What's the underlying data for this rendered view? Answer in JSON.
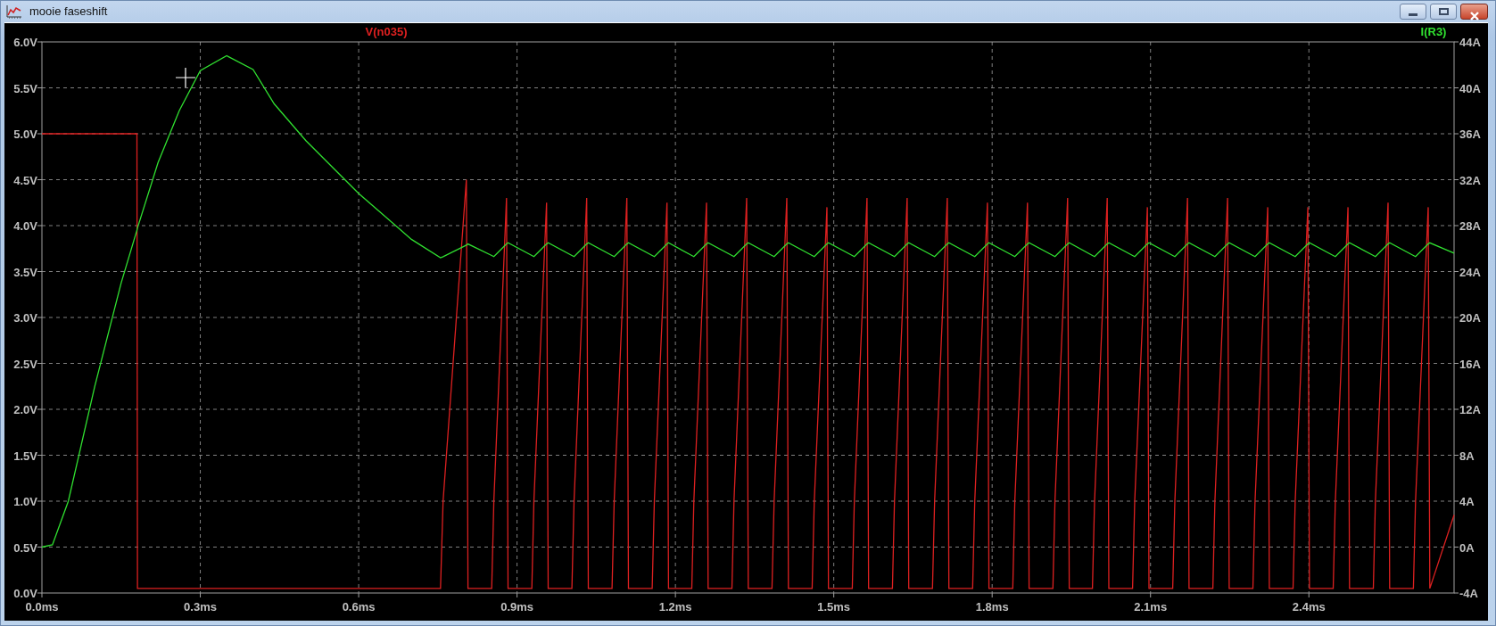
{
  "window": {
    "title": "mooie faseshift"
  },
  "plot": {
    "chart_data": {
      "type": "line",
      "grid": true,
      "xlim": [
        0,
        2.675
      ],
      "ylim": [
        0,
        6
      ],
      "y2lim": [
        -4,
        44
      ],
      "xticks": [
        {
          "value": 0,
          "label": "0.0ms"
        },
        {
          "value": 0.3,
          "label": "0.3ms"
        },
        {
          "value": 0.6,
          "label": "0.6ms"
        },
        {
          "value": 0.9,
          "label": "0.9ms"
        },
        {
          "value": 1.2,
          "label": "1.2ms"
        },
        {
          "value": 1.5,
          "label": "1.5ms"
        },
        {
          "value": 1.8,
          "label": "1.8ms"
        },
        {
          "value": 2.1,
          "label": "2.1ms"
        },
        {
          "value": 2.4,
          "label": "2.4ms"
        }
      ],
      "yticks": [
        {
          "value": 0,
          "label": "0.0V"
        },
        {
          "value": 0.5,
          "label": "0.5V"
        },
        {
          "value": 1,
          "label": "1.0V"
        },
        {
          "value": 1.5,
          "label": "1.5V"
        },
        {
          "value": 2,
          "label": "2.0V"
        },
        {
          "value": 2.5,
          "label": "2.5V"
        },
        {
          "value": 3,
          "label": "3.0V"
        },
        {
          "value": 3.5,
          "label": "3.5V"
        },
        {
          "value": 4,
          "label": "4.0V"
        },
        {
          "value": 4.5,
          "label": "4.5V"
        },
        {
          "value": 5,
          "label": "5.0V"
        },
        {
          "value": 5.5,
          "label": "5.5V"
        },
        {
          "value": 6,
          "label": "6.0V"
        }
      ],
      "y2ticks": [
        {
          "value": -4,
          "label": "-4A"
        },
        {
          "value": 0,
          "label": "0A"
        },
        {
          "value": 4,
          "label": "4A"
        },
        {
          "value": 8,
          "label": "8A"
        },
        {
          "value": 12,
          "label": "12A"
        },
        {
          "value": 16,
          "label": "16A"
        },
        {
          "value": 20,
          "label": "20A"
        },
        {
          "value": 24,
          "label": "24A"
        },
        {
          "value": 28,
          "label": "28A"
        },
        {
          "value": 32,
          "label": "32A"
        },
        {
          "value": 36,
          "label": "36A"
        },
        {
          "value": 40,
          "label": "40A"
        },
        {
          "value": 44,
          "label": "44A"
        }
      ],
      "x": [
        0,
        0.02,
        0.05,
        0.1,
        0.15,
        0.18,
        0.181,
        0.22,
        0.26,
        0.3,
        0.35,
        0.4,
        0.44,
        0.5,
        0.6,
        0.7,
        0.755,
        0.76,
        0.804,
        0.807,
        0.852,
        0.856,
        0.88,
        0.883,
        0.928,
        0.932,
        0.956,
        0.959,
        1.004,
        1.008,
        1.032,
        1.035,
        1.08,
        1.084,
        1.108,
        1.111,
        1.156,
        1.16,
        1.184,
        1.187,
        1.231,
        1.235,
        1.259,
        1.262,
        1.307,
        1.311,
        1.335,
        1.338,
        1.383,
        1.387,
        1.411,
        1.414,
        1.459,
        1.463,
        1.487,
        1.49,
        1.535,
        1.539,
        1.563,
        1.566,
        1.611,
        1.615,
        1.639,
        1.642,
        1.687,
        1.691,
        1.715,
        1.718,
        1.763,
        1.767,
        1.791,
        1.794,
        1.839,
        1.843,
        1.867,
        1.87,
        1.915,
        1.919,
        1.943,
        1.946,
        1.99,
        1.994,
        2.018,
        2.021,
        2.066,
        2.07,
        2.094,
        2.097,
        2.142,
        2.146,
        2.17,
        2.173,
        2.218,
        2.222,
        2.246,
        2.249,
        2.294,
        2.298,
        2.322,
        2.325,
        2.37,
        2.374,
        2.398,
        2.401,
        2.446,
        2.45,
        2.474,
        2.477,
        2.522,
        2.526,
        2.55,
        2.553,
        2.598,
        2.602,
        2.626,
        2.629,
        2.675
      ],
      "series": [
        {
          "name": "V(n035)",
          "color": "#dd2020",
          "values": [
            5,
            5,
            5,
            5,
            5,
            5,
            0.05,
            0.05,
            0.05,
            0.05,
            0.05,
            0.05,
            0.05,
            0.05,
            0.05,
            0.05,
            0.05,
            1.0,
            4.5,
            0.05,
            0.05,
            1.0,
            4.3,
            0.05,
            0.05,
            1.0,
            4.25,
            0.05,
            0.05,
            1.0,
            4.3,
            0.05,
            0.05,
            1.0,
            4.3,
            0.05,
            0.05,
            1.0,
            4.25,
            0.05,
            0.05,
            1.0,
            4.25,
            0.05,
            0.05,
            1.0,
            4.3,
            0.05,
            0.05,
            1.0,
            4.3,
            0.05,
            0.05,
            1.0,
            4.2,
            0.05,
            0.05,
            1.0,
            4.3,
            0.05,
            0.05,
            1.0,
            4.3,
            0.05,
            0.05,
            1.0,
            4.3,
            0.05,
            0.05,
            1.0,
            4.25,
            0.05,
            0.05,
            1.0,
            4.25,
            0.05,
            0.05,
            1.0,
            4.3,
            0.05,
            0.05,
            1.0,
            4.3,
            0.05,
            0.05,
            1.0,
            4.2,
            0.05,
            0.05,
            1.0,
            4.3,
            0.05,
            0.05,
            1.0,
            4.3,
            0.05,
            0.05,
            1.0,
            4.2,
            0.05,
            0.05,
            1.0,
            4.2,
            0.05,
            0.05,
            1.0,
            4.2,
            0.05,
            0.05,
            1.0,
            4.25,
            0.05,
            0.05,
            1.0,
            4.2,
            0.05,
            0.85
          ]
        },
        {
          "name": "I(R3)",
          "color": "#30e030",
          "axis": "y2",
          "values": [
            0,
            0.2,
            4,
            14,
            23,
            27.6,
            27.8,
            33.5,
            38,
            41.5,
            42.8,
            41.6,
            38.6,
            35.4,
            30.8,
            26.8,
            25.2,
            25.3,
            26.3,
            26.4,
            25.4,
            25.3,
            26.4,
            26.5,
            25.4,
            25.3,
            26.4,
            26.5,
            25.4,
            25.3,
            26.4,
            26.5,
            25.4,
            25.3,
            26.4,
            26.5,
            25.4,
            25.3,
            26.4,
            26.5,
            25.4,
            25.3,
            26.4,
            26.5,
            25.4,
            25.3,
            26.4,
            26.5,
            25.4,
            25.3,
            26.4,
            26.5,
            25.4,
            25.3,
            26.4,
            26.5,
            25.4,
            25.3,
            26.4,
            26.5,
            25.4,
            25.3,
            26.4,
            26.5,
            25.4,
            25.3,
            26.4,
            26.5,
            25.4,
            25.3,
            26.4,
            26.5,
            25.4,
            25.3,
            26.4,
            26.5,
            25.4,
            25.3,
            26.4,
            26.5,
            25.4,
            25.3,
            26.4,
            26.5,
            25.4,
            25.3,
            26.4,
            26.5,
            25.4,
            25.3,
            26.4,
            26.5,
            25.4,
            25.3,
            26.4,
            26.5,
            25.4,
            25.3,
            26.4,
            26.5,
            25.4,
            25.3,
            26.4,
            26.5,
            25.4,
            25.3,
            26.4,
            26.5,
            25.4,
            25.3,
            26.4,
            26.5,
            25.4,
            25.3,
            26.4,
            26.5,
            25.6
          ]
        }
      ]
    }
  }
}
